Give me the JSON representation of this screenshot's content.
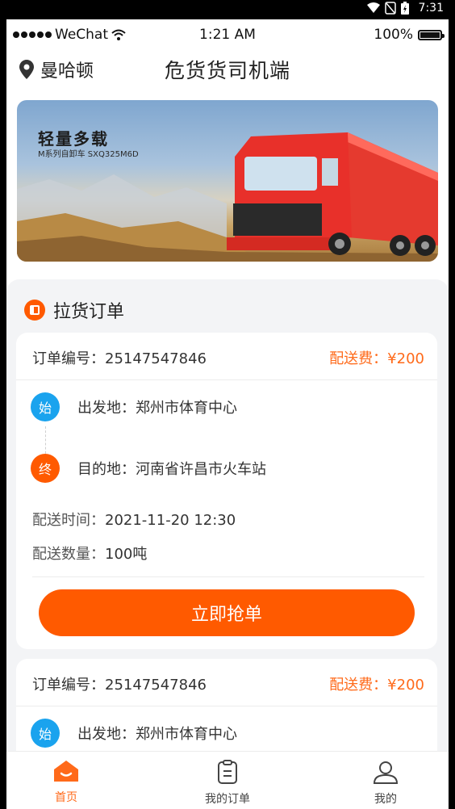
{
  "android_status": {
    "time": "7:31"
  },
  "ios_status": {
    "carrier": "WeChat",
    "time": "1:21 AM",
    "battery": "100%"
  },
  "header": {
    "location": "曼哈顿",
    "title": "危货货司机端",
    "location_icon": "location-pin-icon"
  },
  "banner": {
    "title": "轻量多载",
    "subtitle": "M系列自卸车 SXQ325M6D"
  },
  "section": {
    "title": "拉货订单"
  },
  "orders": [
    {
      "order_no": "订单编号：25147547846",
      "fee": "配送费：¥200",
      "start_badge": "始",
      "start": "出发地：郑州市体育中心",
      "end_badge": "终",
      "end": "目的地：河南省许昌市火车站",
      "time_label": "配送时间：",
      "time_value": "2021-11-20 12:30",
      "qty_label": "配送数量：",
      "qty_value": "100吨",
      "button": "立即抢单"
    },
    {
      "order_no": "订单编号：25147547846",
      "fee": "配送费：¥200",
      "start_badge": "始",
      "start": "出发地：郑州市体育中心"
    }
  ],
  "tabs": [
    {
      "label": "首页",
      "icon": "home-icon",
      "active": true
    },
    {
      "label": "我的订单",
      "icon": "clipboard-icon",
      "active": false
    },
    {
      "label": "我的",
      "icon": "user-icon",
      "active": false
    }
  ],
  "colors": {
    "accent": "#ff5a00",
    "fee": "#ff6a1a",
    "start_badge": "#1aa3ee"
  }
}
